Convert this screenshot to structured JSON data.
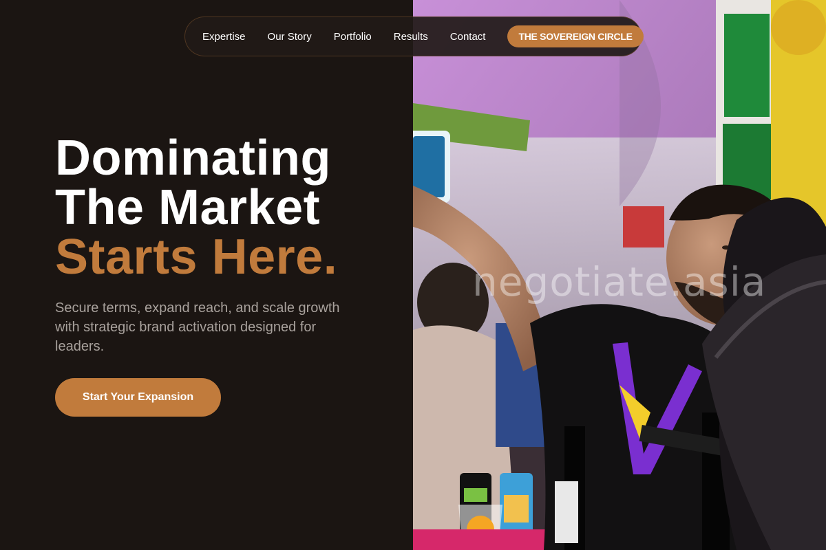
{
  "nav": {
    "links": [
      "Expertise",
      "Our Story",
      "Portfolio",
      "Results",
      "Contact"
    ],
    "cta_label": "THE SOVEREIGN CIRCLE"
  },
  "hero": {
    "title_line1": "Dominating",
    "title_line2": "The Market",
    "title_accent": "Starts Here.",
    "subtitle": "Secure terms, expand reach, and scale growth with strategic brand activation designed for leaders.",
    "cta_label": "Start Your Expansion"
  },
  "photo": {
    "watermark": "negotiate.asia"
  },
  "colors": {
    "background": "#1b1512",
    "accent": "#c17b3c",
    "text": "#ffffff",
    "muted_text": "#a8a19c"
  }
}
